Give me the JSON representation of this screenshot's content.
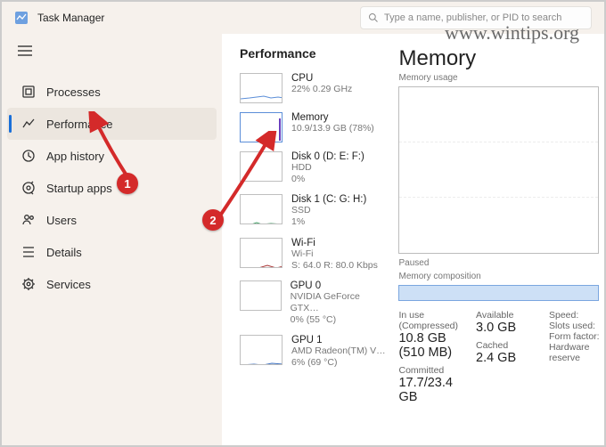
{
  "app": {
    "title": "Task Manager"
  },
  "search": {
    "placeholder": "Type a name, publisher, or PID to search"
  },
  "watermark": "www.wintips.org",
  "nav": {
    "processes": "Processes",
    "performance": "Performance",
    "apphistory": "App history",
    "startup": "Startup apps",
    "users": "Users",
    "details": "Details",
    "services": "Services"
  },
  "perf": {
    "header": "Performance",
    "tiles": {
      "cpu": {
        "label": "CPU",
        "sub": "22%  0.29 GHz"
      },
      "memory": {
        "label": "Memory",
        "sub": "10.9/13.9 GB (78%)"
      },
      "disk0": {
        "label": "Disk 0 (D: E: F:)",
        "sub1": "HDD",
        "sub2": "0%"
      },
      "disk1": {
        "label": "Disk 1 (C: G: H:)",
        "sub1": "SSD",
        "sub2": "1%"
      },
      "wifi": {
        "label": "Wi-Fi",
        "sub1": "Wi-Fi",
        "sub2": "S: 64.0 R: 80.0 Kbps"
      },
      "gpu0": {
        "label": "GPU 0",
        "sub1": "NVIDIA GeForce GTX…",
        "sub2": "0%  (55 °C)"
      },
      "gpu1": {
        "label": "GPU 1",
        "sub1": "AMD Radeon(TM) V…",
        "sub2": "6%  (69 °C)"
      }
    },
    "detail": {
      "title": "Memory",
      "usage_label": "Memory usage",
      "paused": "Paused",
      "compo_label": "Memory composition",
      "stats": {
        "inuse_label": "In use (Compressed)",
        "inuse": "10.8 GB (510 MB)",
        "avail_label": "Available",
        "avail": "3.0 GB",
        "committed_label": "Committed",
        "committed": "17.7/23.4 GB",
        "cached_label": "Cached",
        "cached": "2.4 GB",
        "speed_label": "Speed:",
        "slots_label": "Slots used:",
        "form_label": "Form factor:",
        "hw_label": "Hardware reserve"
      }
    }
  },
  "callouts": {
    "one": "1",
    "two": "2"
  }
}
